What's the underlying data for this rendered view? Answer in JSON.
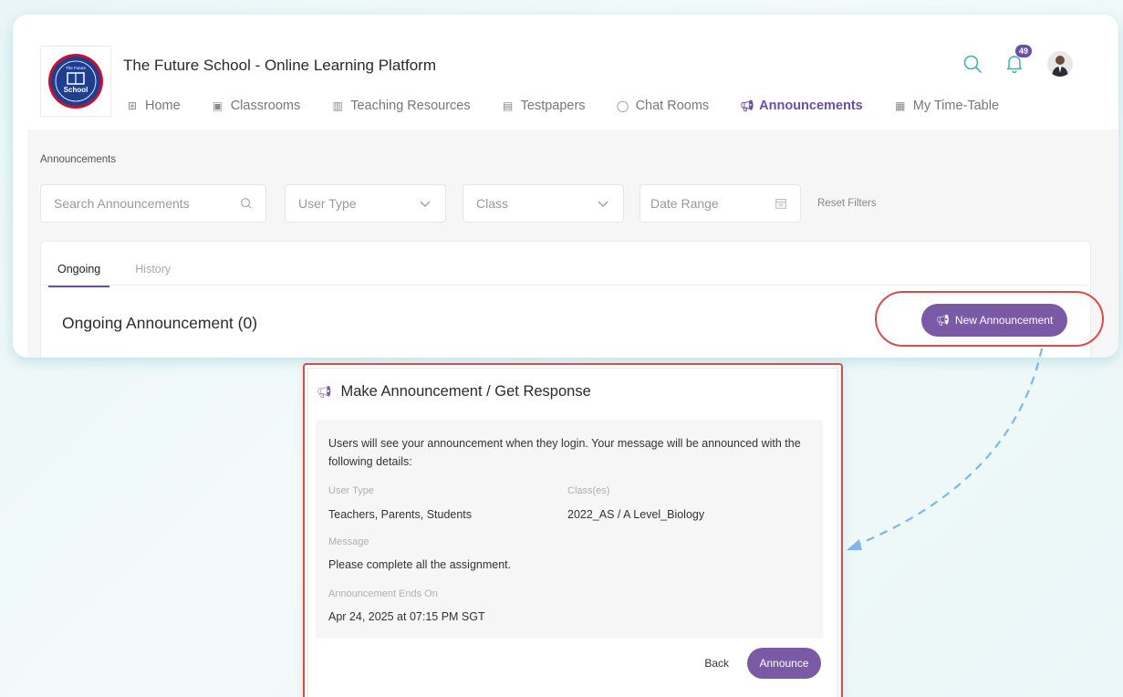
{
  "app": {
    "title": "The Future School - Online Learning Platform",
    "logo_text": "School",
    "logo_arc_text": "The Future"
  },
  "nav": [
    {
      "label": "Home",
      "icon": "grid-icon",
      "active": false
    },
    {
      "label": "Classrooms",
      "icon": "classroom-icon",
      "active": false
    },
    {
      "label": "Teaching Resources",
      "icon": "book-icon",
      "active": false
    },
    {
      "label": "Testpapers",
      "icon": "testpaper-icon",
      "active": false
    },
    {
      "label": "Chat Rooms",
      "icon": "chat-icon",
      "active": false
    },
    {
      "label": "Announcements",
      "icon": "megaphone-icon",
      "active": true
    },
    {
      "label": "My Time-Table",
      "icon": "calendar-icon",
      "active": false
    }
  ],
  "header": {
    "notification_count": "49"
  },
  "breadcrumb": "Announcements",
  "filters": {
    "search_placeholder": "Search Announcements",
    "user_type": "User Type",
    "class": "Class",
    "date_range": "Date Range",
    "reset": "Reset Filters"
  },
  "tabs": [
    {
      "label": "Ongoing",
      "active": true
    },
    {
      "label": "History",
      "active": false
    }
  ],
  "ongoing_title": "Ongoing Announcement (0)",
  "new_button": "New Announcement",
  "modal": {
    "title": "Make Announcement / Get Response",
    "intro": "Users will see your announcement when they login. Your message will be announced with the following details:",
    "user_type_label": "User Type",
    "user_type_value": "Teachers, Parents, Students",
    "class_label": "Class(es)",
    "class_value": "2022_AS / A Level_Biology",
    "message_label": "Message",
    "message_value": "Please complete all the assignment.",
    "ends_label": "Announcement Ends On",
    "ends_value": "Apr 24, 2025 at 07:15 PM SGT",
    "back": "Back",
    "announce": "Announce"
  },
  "colors": {
    "accent": "#7a5aa6",
    "highlight": "#d94c4c",
    "teal": "#3cb6a8",
    "arrow": "#7fb8e6"
  }
}
